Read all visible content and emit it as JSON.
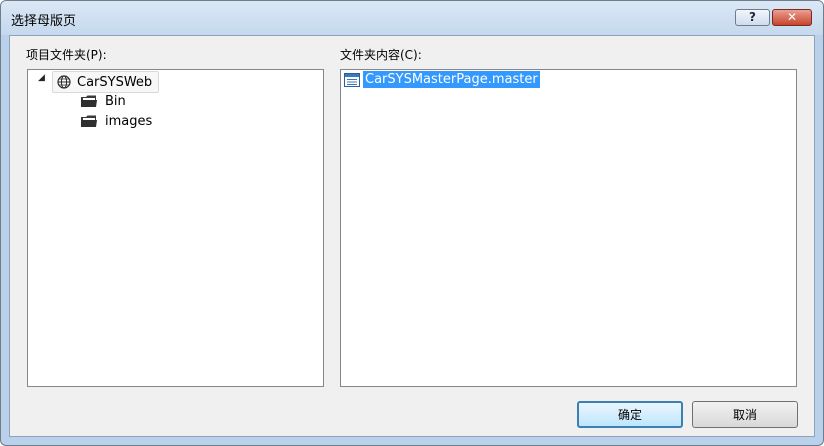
{
  "window": {
    "title": "选择母版页",
    "help_label": "?",
    "close_label": "✕"
  },
  "left_panel": {
    "label": "项目文件夹(P):",
    "tree": {
      "root": "CarSYSWeb",
      "children": [
        "Bin",
        "images"
      ]
    }
  },
  "right_panel": {
    "label": "文件夹内容(C):",
    "files": [
      "CarSYSMasterPage.master"
    ]
  },
  "buttons": {
    "ok": "确定",
    "cancel": "取消"
  },
  "colors": {
    "selection": "#3399ff",
    "close_button": "#c8442d",
    "dialog_background": "#f0f0f0"
  },
  "icons": {
    "root": "globe-icon",
    "folder": "folder-icon",
    "file": "master-page-file-icon",
    "expander": "tree-expanded-icon"
  }
}
